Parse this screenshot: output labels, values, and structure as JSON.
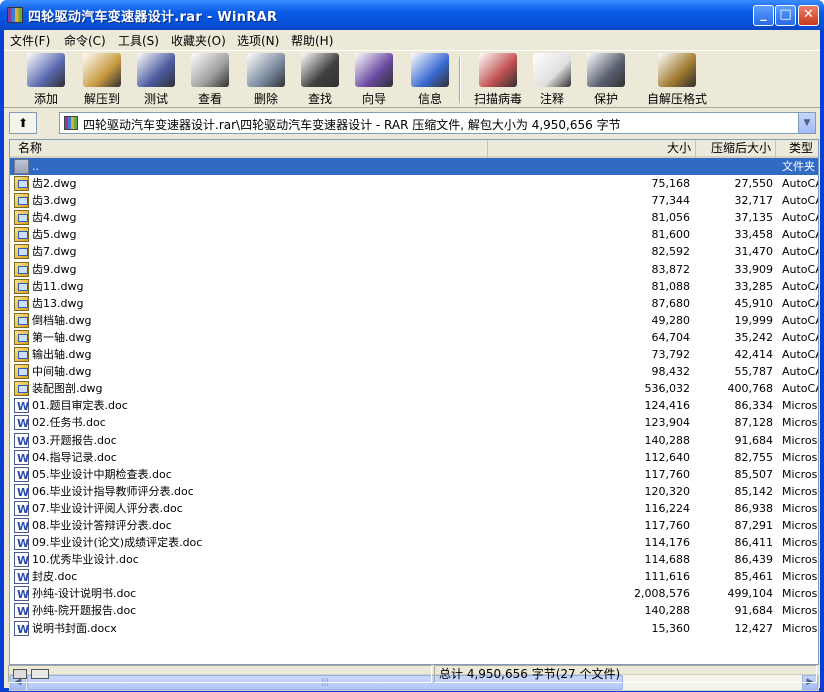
{
  "window": {
    "title": "四轮驱动汽车变速器设计.rar - WinRAR"
  },
  "menu": [
    "文件(F)",
    "命令(C)",
    "工具(S)",
    "收藏夹(O)",
    "选项(N)",
    "帮助(H)"
  ],
  "toolbar": [
    {
      "label": "添加",
      "icon": "add-archive-icon",
      "color": "#5a6ab0"
    },
    {
      "label": "解压到",
      "icon": "extract-to-icon",
      "color": "#c89a40"
    },
    {
      "label": "测试",
      "icon": "test-icon",
      "color": "#4a5aa0"
    },
    {
      "label": "查看",
      "icon": "view-icon",
      "color": "#a0a0a0"
    },
    {
      "label": "删除",
      "icon": "delete-icon",
      "color": "#7a8aa0"
    },
    {
      "label": "查找",
      "icon": "find-icon",
      "color": "#404040"
    },
    {
      "label": "向导",
      "icon": "wizard-icon",
      "color": "#6a4aa0"
    },
    {
      "label": "信息",
      "icon": "info-icon",
      "color": "#3a6ad0"
    },
    {
      "label": "扫描病毒",
      "icon": "virus-scan-icon",
      "color": "#c05050"
    },
    {
      "label": "注释",
      "icon": "comment-icon",
      "color": "#e0e0e0"
    },
    {
      "label": "保护",
      "icon": "protect-icon",
      "color": "#5a6070"
    },
    {
      "label": "自解压格式",
      "icon": "sfx-icon",
      "color": "#a07a30"
    }
  ],
  "address": {
    "text": "四轮驱动汽车变速器设计.rar\\四轮驱动汽车变速器设计 - RAR 压缩文件, 解包大小为 4,950,656 字节"
  },
  "columns": {
    "name": "名称",
    "size": "大小",
    "packed": "压缩后大小",
    "type": "类型"
  },
  "files": [
    {
      "name": "..",
      "size": "",
      "packed": "",
      "type": "文件夹",
      "kind": "folder"
    },
    {
      "name": "齿2.dwg",
      "size": "75,168",
      "packed": "27,550",
      "type": "AutoCAD",
      "kind": "dwg"
    },
    {
      "name": "齿3.dwg",
      "size": "77,344",
      "packed": "32,717",
      "type": "AutoCAD",
      "kind": "dwg"
    },
    {
      "name": "齿4.dwg",
      "size": "81,056",
      "packed": "37,135",
      "type": "AutoCAD",
      "kind": "dwg"
    },
    {
      "name": "齿5.dwg",
      "size": "81,600",
      "packed": "33,458",
      "type": "AutoCAD",
      "kind": "dwg"
    },
    {
      "name": "齿7.dwg",
      "size": "82,592",
      "packed": "31,470",
      "type": "AutoCAD",
      "kind": "dwg"
    },
    {
      "name": "齿9.dwg",
      "size": "83,872",
      "packed": "33,909",
      "type": "AutoCAD",
      "kind": "dwg"
    },
    {
      "name": "齿11.dwg",
      "size": "81,088",
      "packed": "33,285",
      "type": "AutoCAD",
      "kind": "dwg"
    },
    {
      "name": "齿13.dwg",
      "size": "87,680",
      "packed": "45,910",
      "type": "AutoCAD",
      "kind": "dwg"
    },
    {
      "name": "倒档轴.dwg",
      "size": "49,280",
      "packed": "19,999",
      "type": "AutoCAD",
      "kind": "dwg"
    },
    {
      "name": "第一轴.dwg",
      "size": "64,704",
      "packed": "35,242",
      "type": "AutoCAD",
      "kind": "dwg"
    },
    {
      "name": "输出轴.dwg",
      "size": "73,792",
      "packed": "42,414",
      "type": "AutoCAD",
      "kind": "dwg"
    },
    {
      "name": "中间轴.dwg",
      "size": "98,432",
      "packed": "55,787",
      "type": "AutoCAD",
      "kind": "dwg"
    },
    {
      "name": "装配图剖.dwg",
      "size": "536,032",
      "packed": "400,768",
      "type": "AutoCAD",
      "kind": "dwg"
    },
    {
      "name": "01.题目审定表.doc",
      "size": "124,416",
      "packed": "86,334",
      "type": "Microsoft",
      "kind": "doc"
    },
    {
      "name": "02.任务书.doc",
      "size": "123,904",
      "packed": "87,128",
      "type": "Microsoft",
      "kind": "doc"
    },
    {
      "name": "03.开题报告.doc",
      "size": "140,288",
      "packed": "91,684",
      "type": "Microsoft",
      "kind": "doc"
    },
    {
      "name": "04.指导记录.doc",
      "size": "112,640",
      "packed": "82,755",
      "type": "Microsoft",
      "kind": "doc"
    },
    {
      "name": "05.毕业设计中期检查表.doc",
      "size": "117,760",
      "packed": "85,507",
      "type": "Microsoft",
      "kind": "doc"
    },
    {
      "name": "06.毕业设计指导教师评分表.doc",
      "size": "120,320",
      "packed": "85,142",
      "type": "Microsoft",
      "kind": "doc"
    },
    {
      "name": "07.毕业设计评阅人评分表.doc",
      "size": "116,224",
      "packed": "86,938",
      "type": "Microsoft",
      "kind": "doc"
    },
    {
      "name": "08.毕业设计答辩评分表.doc",
      "size": "117,760",
      "packed": "87,291",
      "type": "Microsoft",
      "kind": "doc"
    },
    {
      "name": "09.毕业设计(论文)成绩评定表.doc",
      "size": "114,176",
      "packed": "86,411",
      "type": "Microsoft",
      "kind": "doc"
    },
    {
      "name": "10.优秀毕业设计.doc",
      "size": "114,688",
      "packed": "86,439",
      "type": "Microsoft",
      "kind": "doc"
    },
    {
      "name": "封皮.doc",
      "size": "111,616",
      "packed": "85,461",
      "type": "Microsoft",
      "kind": "doc"
    },
    {
      "name": "孙纯-设计说明书.doc",
      "size": "2,008,576",
      "packed": "499,104",
      "type": "Microsoft",
      "kind": "doc"
    },
    {
      "name": "孙纯-院开题报告.doc",
      "size": "140,288",
      "packed": "91,684",
      "type": "Microsoft",
      "kind": "doc"
    },
    {
      "name": "说明书封面.docx",
      "size": "15,360",
      "packed": "12,427",
      "type": "Microsoft",
      "kind": "doc"
    }
  ],
  "status": {
    "right": "总计 4,950,656 字节(27 个文件)"
  }
}
